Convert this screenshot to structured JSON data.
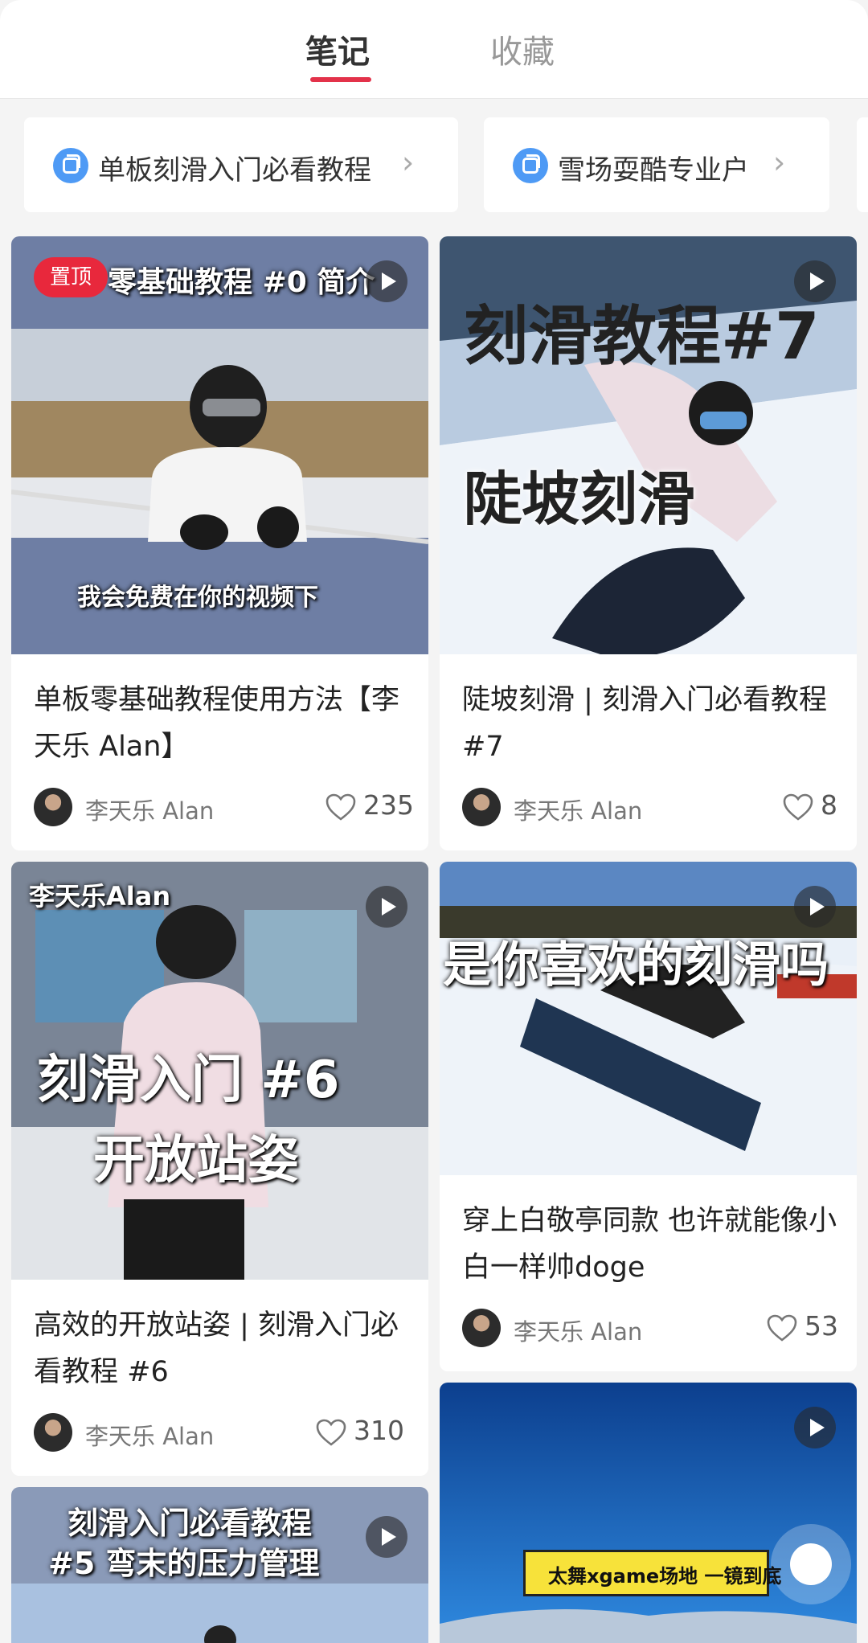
{
  "tabs": {
    "notes": "笔记",
    "favorites": "收藏"
  },
  "albums": [
    {
      "label": "单板刻滑入门必看教程",
      "icon": "album-icon",
      "chevron": "›"
    },
    {
      "label": "雪场耍酷专业户",
      "icon": "album-icon",
      "chevron": "›"
    }
  ],
  "cards": [
    {
      "cover_text": [
        "零基础教程 #0 简介",
        "我会免费在你的视频下"
      ],
      "pinned_label": "置顶",
      "title": "单板零基础教程使用方法【李天乐 Alan】",
      "author": "李天乐 Alan",
      "likes": "235"
    },
    {
      "cover_text": [
        "刻滑教程#7",
        "陡坡刻滑"
      ],
      "title": "陡坡刻滑 | 刻滑入门必看教程#7",
      "author": "李天乐 Alan",
      "likes": "8"
    },
    {
      "cover_text": [
        "李天乐Alan",
        "刻滑入门 #6",
        "开放站姿"
      ],
      "title": "高效的开放站姿 | 刻滑入门必看教程 #6",
      "author": "李天乐 Alan",
      "likes": "310"
    },
    {
      "cover_text": [
        "是你喜欢的刻滑吗"
      ],
      "title": "穿上白敬亭同款 也许就能像小白一样帅doge",
      "author": "李天乐 Alan",
      "likes": "53"
    },
    {
      "cover_text": [
        "刻滑入门必看教程",
        "#5 弯末的压力管理"
      ]
    },
    {
      "cover_text": [
        "太舞xgame场地 一镜到底"
      ]
    }
  ],
  "colors": {
    "accent": "#e3324a",
    "pin": "#e8283c",
    "album_icon": "#4e9af5"
  },
  "icons": {
    "like": "heart-outline-icon",
    "play": "play-icon",
    "album": "album-icon"
  }
}
